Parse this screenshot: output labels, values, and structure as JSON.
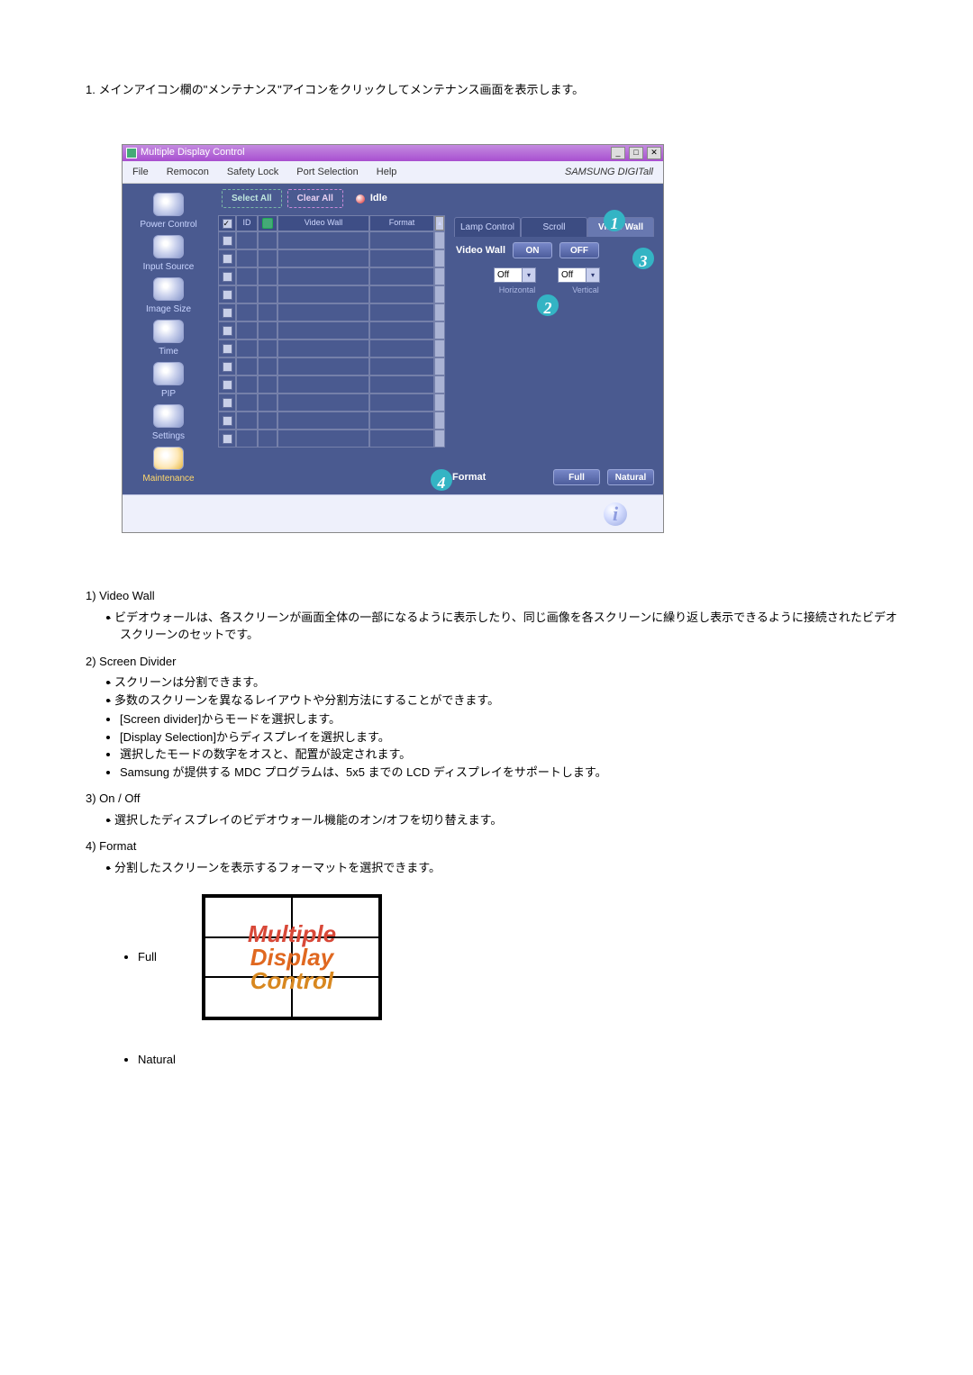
{
  "intro": "1.  メインアイコン欄の\"メンテナンス\"アイコンをクリックしてメンテナンス画面を表示します。",
  "window": {
    "title": "Multiple Display Control",
    "win_btns": {
      "min": "_",
      "max": "□",
      "close": "✕"
    },
    "menu": [
      "File",
      "Remocon",
      "Safety Lock",
      "Port Selection",
      "Help"
    ],
    "brand": "SAMSUNG DIGITall"
  },
  "sidebar": [
    {
      "label": "Power Control"
    },
    {
      "label": "Input Source"
    },
    {
      "label": "Image Size"
    },
    {
      "label": "Time"
    },
    {
      "label": "PIP"
    },
    {
      "label": "Settings"
    },
    {
      "label": "Maintenance"
    }
  ],
  "toolbar": {
    "select_all": "Select All",
    "clear_all": "Clear All",
    "idle": "Idle"
  },
  "grid": {
    "headers": {
      "id": "ID",
      "video_wall": "Video Wall",
      "format": "Format"
    },
    "rows": 12
  },
  "panel": {
    "tabs": [
      "Lamp Control",
      "Scroll",
      "Video Wall"
    ],
    "vw_label": "Video Wall",
    "on": "ON",
    "off": "OFF",
    "sel_h": "Off",
    "sel_v": "Off",
    "lbl_h": "Horizontal",
    "lbl_v": "Vertical",
    "format_label": "Format",
    "full": "Full",
    "natural": "Natural"
  },
  "badges": {
    "b1": "1",
    "b2": "2",
    "b3": "3",
    "b4": "4"
  },
  "status_info": "i",
  "sections": [
    {
      "num": "1)",
      "title": "Video Wall",
      "dash": [
        "ビデオウォールは、各スクリーンが画面全体の一部になるように表示したり、同じ画像を各スクリーンに繰り返し表示できるように接続されたビデオスクリーンのセットです。"
      ]
    },
    {
      "num": "2)",
      "title": "Screen Divider",
      "dash": [
        "スクリーンは分割できます。",
        "多数のスクリーンを異なるレイアウトや分割方法にすることができます。"
      ],
      "bullets": [
        "[Screen divider]からモードを選択します。",
        "[Display Selection]からディスプレイを選択します。",
        "選択したモードの数字をオスと、配置が設定されます。",
        "Samsung が提供する MDC プログラムは、5x5 までの LCD ディスプレイをサポートします。"
      ]
    },
    {
      "num": "3)",
      "title": "On / Off",
      "dash": [
        "選択したディスプレイのビデオウォール機能のオン/オフを切り替えます。"
      ]
    },
    {
      "num": "4)",
      "title": "Format",
      "dash": [
        "分割したスクリーンを表示するフォーマットを選択できます。"
      ]
    }
  ],
  "full_label": "Full",
  "thumb_lines": [
    "Multiple",
    "Display",
    "Control"
  ],
  "natural_label": "Natural"
}
